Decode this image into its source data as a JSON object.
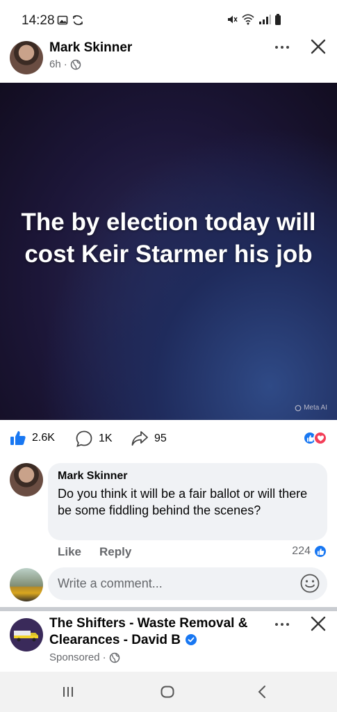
{
  "status_bar": {
    "time": "14:28",
    "left_icons": [
      "image-icon",
      "sync-icon"
    ],
    "right_icons": [
      "mute-icon",
      "wifi-icon",
      "signal-icon",
      "battery-icon"
    ]
  },
  "post": {
    "author": "Mark Skinner",
    "time": "6h",
    "separator": "·",
    "privacy_icon": "globe-icon",
    "image_text": "The by election today will cost Keir Starmer his job",
    "ai_label": "Meta AI",
    "likes_count": "2.6K",
    "comments_count": "1K",
    "shares_count": "95",
    "reactions": [
      "like",
      "love"
    ]
  },
  "comment": {
    "author": "Mark Skinner",
    "text": "Do you think it will be a fair ballot or will there be some fiddling behind the scenes?",
    "like_label": "Like",
    "reply_label": "Reply",
    "likes": "224"
  },
  "write_comment": {
    "placeholder": "Write a comment..."
  },
  "sponsored_post": {
    "name_line": "The Shifters - Waste Removal & Clearances - David B",
    "label": "Sponsored",
    "separator": "·"
  },
  "colors": {
    "brand_blue": "#1877f2",
    "love_red": "#f33e58",
    "bubble_gray": "#f0f2f5",
    "meta_gray": "#65676b"
  }
}
